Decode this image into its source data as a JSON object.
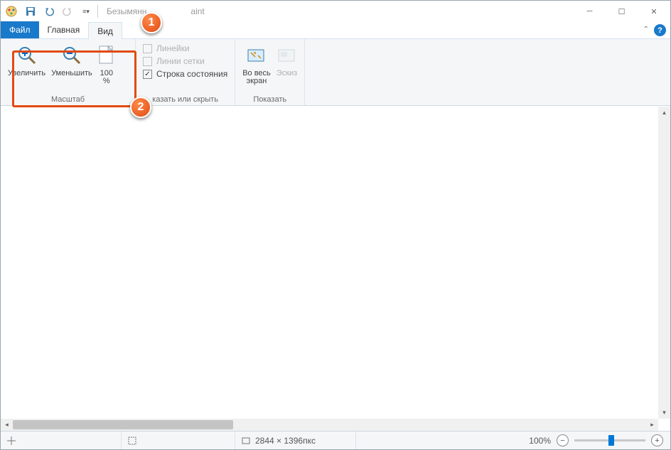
{
  "title": {
    "doc": "Безымянн",
    "app": "aint"
  },
  "tabs": {
    "file": "Файл",
    "home": "Главная",
    "view": "Вид"
  },
  "ribbon": {
    "zoom": {
      "title": "Масштаб",
      "zoom_in": "Увеличить",
      "zoom_out": "Уменьшить",
      "hundred_top": "100",
      "hundred_bot": "%"
    },
    "showhide": {
      "title": "казать или скрыть",
      "rulers": "Линейки",
      "gridlines": "Линии сетки",
      "statusbar": "Строка состояния"
    },
    "display": {
      "title": "Показать",
      "fullscreen_top": "Во весь",
      "fullscreen_bot": "экран",
      "thumbnail": "Эскиз"
    }
  },
  "status": {
    "dimensions": "2844 × 1396пкс",
    "zoom": "100%"
  },
  "annotations": {
    "c1": "1",
    "c2": "2"
  }
}
